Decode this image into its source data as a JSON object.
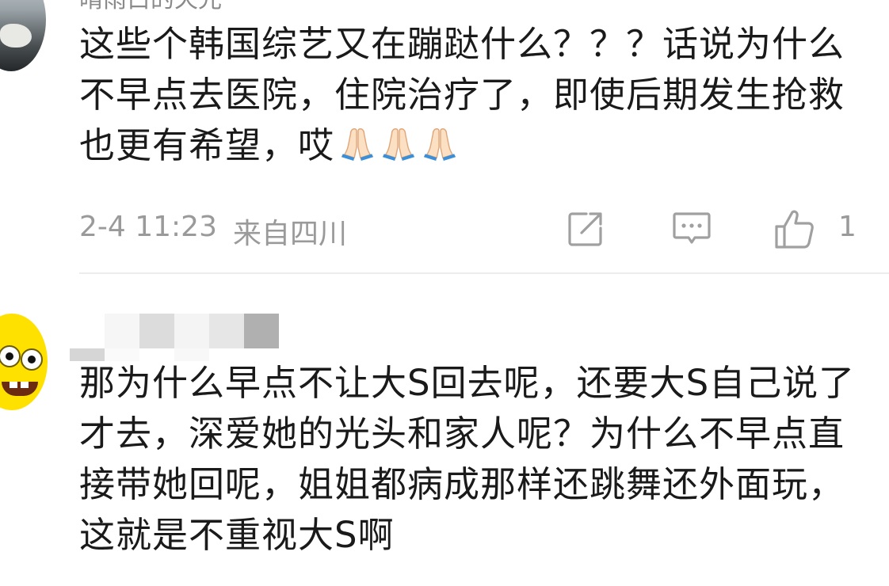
{
  "comments": [
    {
      "username": "晴雨白的天光",
      "text": "这些个韩国综艺又在蹦跶什么？？？话说为什么不早点去医院，住院治疗了，即使后期发生抢救也更有希望，哎",
      "emojis": [
        "folded-hands",
        "folded-hands",
        "folded-hands"
      ],
      "time": "2-4 11:23",
      "location": "来自四川",
      "likes": "1"
    },
    {
      "username": "",
      "text": "那为什么早点不让大S回去呢，还要大S自己说了才去，深爱她的光头和家人呢？为什么不早点直接带她回呢，姐姐都病成那样还跳舞还外面玩，这就是不重视大S啊"
    }
  ],
  "colors": {
    "text": "#1a1a1a",
    "meta": "#9a9a9a",
    "icon": "#a0a0a0",
    "divider": "#ececec",
    "avatar2_bg": "#ffe100"
  }
}
